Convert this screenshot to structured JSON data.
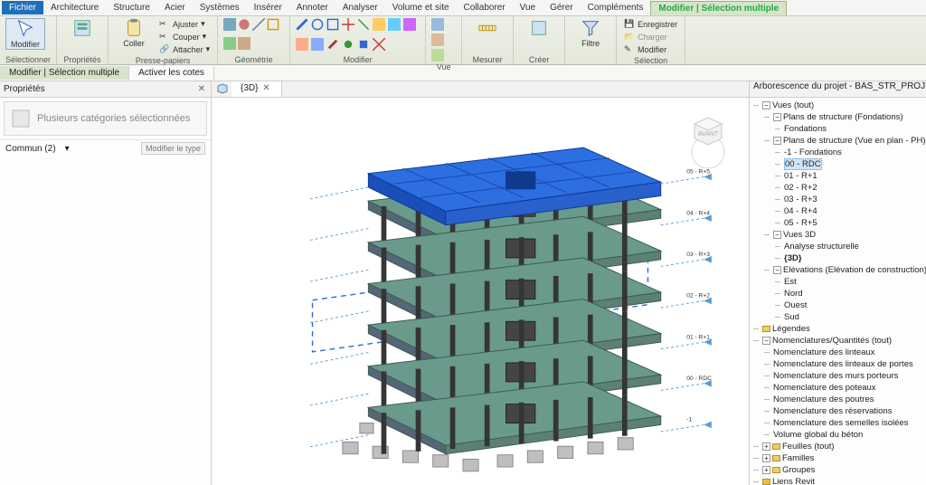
{
  "menu": {
    "file": "Fichier",
    "tabs": [
      "Architecture",
      "Structure",
      "Acier",
      "Systèmes",
      "Insérer",
      "Annoter",
      "Analyser",
      "Volume et site",
      "Collaborer",
      "Vue",
      "Gérer",
      "Compléments"
    ],
    "active": "Modifier | Sélection multiple"
  },
  "ribbon": {
    "panels": [
      {
        "title": "Sélectionner",
        "big": [
          {
            "label": "Modifier",
            "icon": "cursor"
          }
        ]
      },
      {
        "title": "Propriétés",
        "big": [
          {
            "label": "",
            "icon": "props"
          }
        ]
      },
      {
        "title": "Presse-papiers",
        "big": [
          {
            "label": "Coller",
            "icon": "paste"
          }
        ],
        "mini": [
          "Ajuster",
          "Couper",
          "Attacher"
        ]
      },
      {
        "title": "Géométrie",
        "grid": true
      },
      {
        "title": "Modifier",
        "grid": true
      },
      {
        "title": "Vue",
        "grid": true
      },
      {
        "title": "Mesurer",
        "big": [
          {
            "label": "",
            "icon": "measure"
          }
        ]
      },
      {
        "title": "Créer",
        "big": [
          {
            "label": "",
            "icon": "create"
          }
        ]
      },
      {
        "title": "",
        "big": [
          {
            "label": "Filtre",
            "icon": "filter"
          }
        ]
      },
      {
        "title": "Sélection",
        "mini2": [
          "Enregistrer",
          "Charger",
          "Modifier"
        ]
      }
    ]
  },
  "subtabs": [
    "Modifier | Sélection multiple",
    "Activer les cotes"
  ],
  "props": {
    "title": "Propriétés",
    "type_hint": "Plusieurs catégories sélectionnées",
    "row_label": "Commun (2)",
    "edit_type": "Modifier le type"
  },
  "view": {
    "tabs": [
      {
        "label": "{3D}"
      }
    ]
  },
  "viewcube": {
    "face": "AVANT"
  },
  "browser": {
    "title": "Arborescence du projet - BAS_STR_PROJET_TYP",
    "root": "Vues (tout)",
    "groups": [
      {
        "label": "Plans de structure (Fondations)",
        "items": [
          "Fondations"
        ]
      },
      {
        "label": "Plans de structure (Vue en plan - PH)",
        "items": [
          "-1 - Fondations",
          "00 - RDC",
          "01 - R+1",
          "02 - R+2",
          "03 - R+3",
          "04 - R+4",
          "05 - R+5"
        ],
        "selected": "00 - RDC"
      },
      {
        "label": "Vues 3D",
        "items": [
          "Analyse structurelle",
          "{3D}"
        ],
        "bold": "{3D}"
      },
      {
        "label": "Elévations (Elévation de construction)",
        "items": [
          "Est",
          "Nord",
          "Ouest",
          "Sud"
        ]
      }
    ],
    "flat": [
      "Légendes",
      "Nomenclatures/Quantités (tout)"
    ],
    "nomenclatures": [
      "Nomenclature des linteaux",
      "Nomenclature des linteaux de portes",
      "Nomenclature des murs porteurs",
      "Nomenclature des poteaux",
      "Nomenclature des poutres",
      "Nomenclature des réservations",
      "Nomenclature des semelles isolées",
      "Volume global du béton"
    ],
    "bottom": [
      "Feuilles (tout)",
      "Familles",
      "Groupes",
      "Liens Revit"
    ]
  },
  "levels": [
    "05 - R+5",
    "04 - R+4",
    "03 - R+3",
    "02 - R+2",
    "01 - R+1",
    "00 - RDC",
    "-1"
  ],
  "colors": {
    "accent": "#1e6fb8",
    "slab": "#6a9a8c",
    "top": "#1f5fd8"
  }
}
